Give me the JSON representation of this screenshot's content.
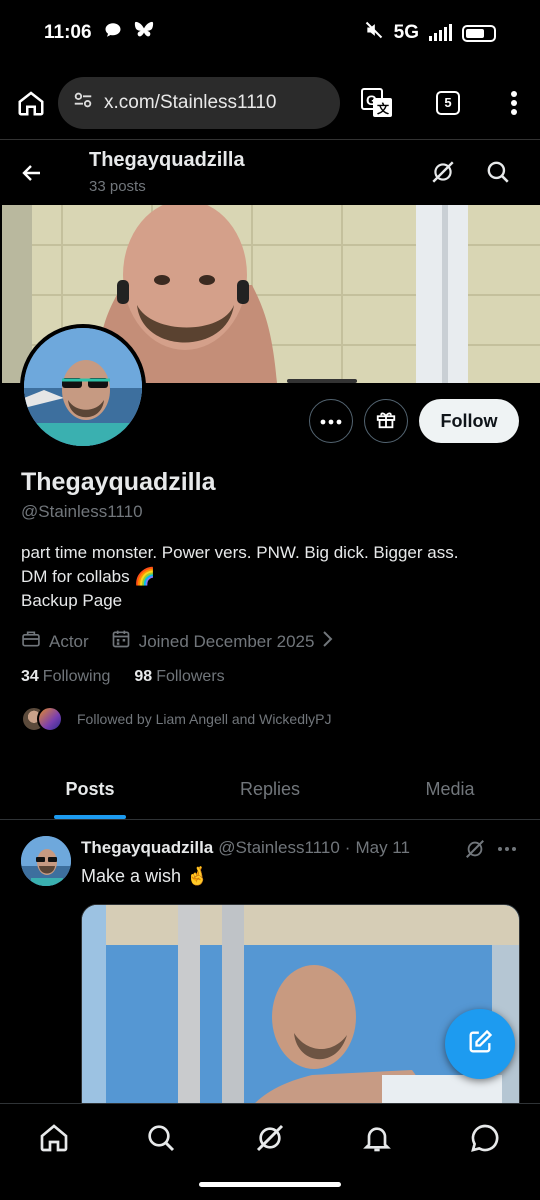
{
  "status_bar": {
    "time": "11:06",
    "network": "5G"
  },
  "browser": {
    "url": "x.com/Stainless1110",
    "tab_count": "5"
  },
  "header": {
    "title": "Thegayquadzilla",
    "post_count": "33 posts"
  },
  "profile": {
    "display_name": "Thegayquadzilla",
    "handle": "@Stainless1110",
    "bio_line1": "part time monster. Power vers. PNW. Big dick. Bigger ass.",
    "bio_line2": "DM for collabs 🌈",
    "bio_line3": "Backup Page",
    "category": "Actor",
    "joined": "Joined December 2025",
    "following_count": "34",
    "following_label": "Following",
    "followers_count": "98",
    "followers_label": "Followers",
    "followed_by": "Followed by Liam Angell and WickedlyPJ",
    "follow_label": "Follow"
  },
  "tabs": [
    {
      "label": "Posts",
      "active": true
    },
    {
      "label": "Replies",
      "active": false
    },
    {
      "label": "Media",
      "active": false
    }
  ],
  "post": {
    "name": "Thegayquadzilla",
    "handle": "@Stainless1110",
    "separator": "·",
    "date": "May 11",
    "text": "Make a wish 🤞"
  },
  "colors": {
    "accent": "#1d9bf0",
    "background": "#000000",
    "muted": "#71767b",
    "text": "#e7e9ea"
  },
  "icons": [
    "home-icon",
    "search-icon",
    "grok-icon",
    "bell-icon",
    "messages-icon",
    "compose-icon",
    "gift-icon",
    "more-icon",
    "briefcase-icon",
    "calendar-icon",
    "back-arrow-icon",
    "translate-icon"
  ]
}
